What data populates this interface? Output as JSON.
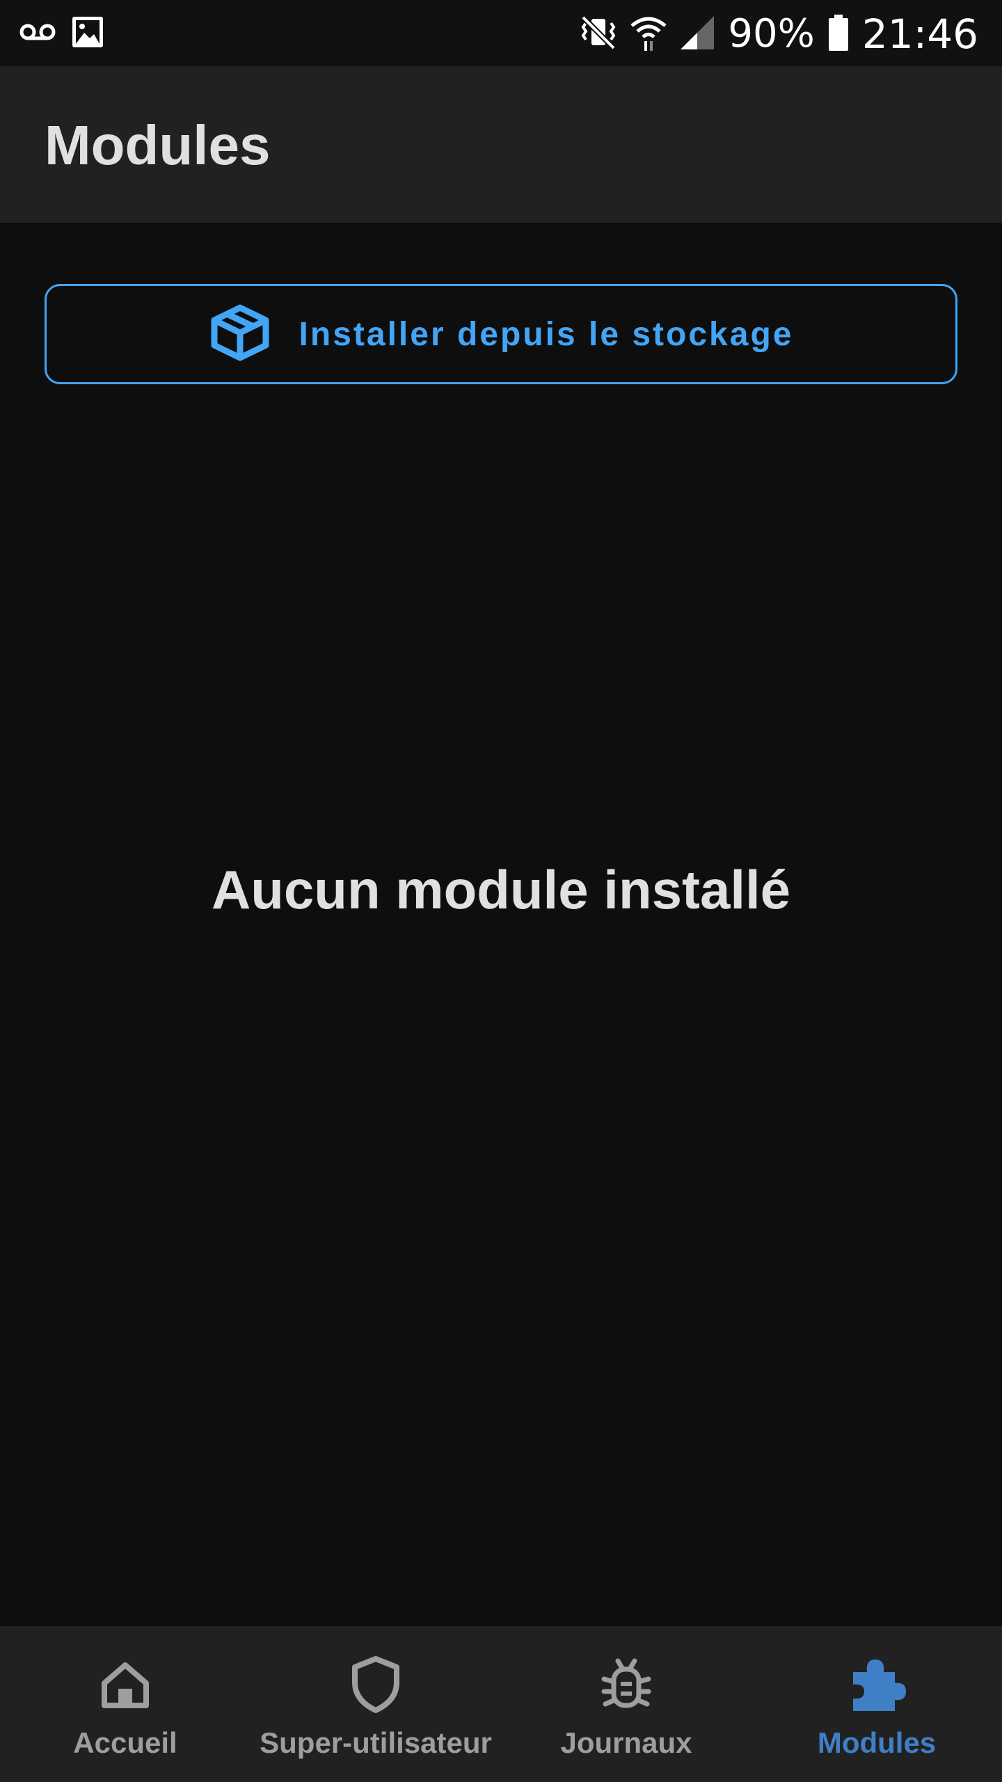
{
  "status_bar": {
    "battery_percent": "90%",
    "time": "21:46",
    "icons_left": [
      "voicemail-icon",
      "image-icon"
    ],
    "icons_right": [
      "vibrate-icon",
      "wifi-icon",
      "signal-icon",
      "battery-icon"
    ]
  },
  "app_bar": {
    "title": "Modules"
  },
  "install_button": {
    "label": "Installer depuis le stockage",
    "icon": "package-box-icon",
    "color": "#42a5f5"
  },
  "empty_state": {
    "message": "Aucun module installé"
  },
  "bottom_nav": {
    "items": [
      {
        "label": "Accueil",
        "icon": "home-icon",
        "active": false
      },
      {
        "label": "Super-utilisateur",
        "icon": "shield-icon",
        "active": false
      },
      {
        "label": "Journaux",
        "icon": "bug-icon",
        "active": false
      },
      {
        "label": "Modules",
        "icon": "puzzle-icon",
        "active": true
      }
    ],
    "active_color": "#3f7fc6",
    "inactive_color": "#9e9e9e"
  }
}
